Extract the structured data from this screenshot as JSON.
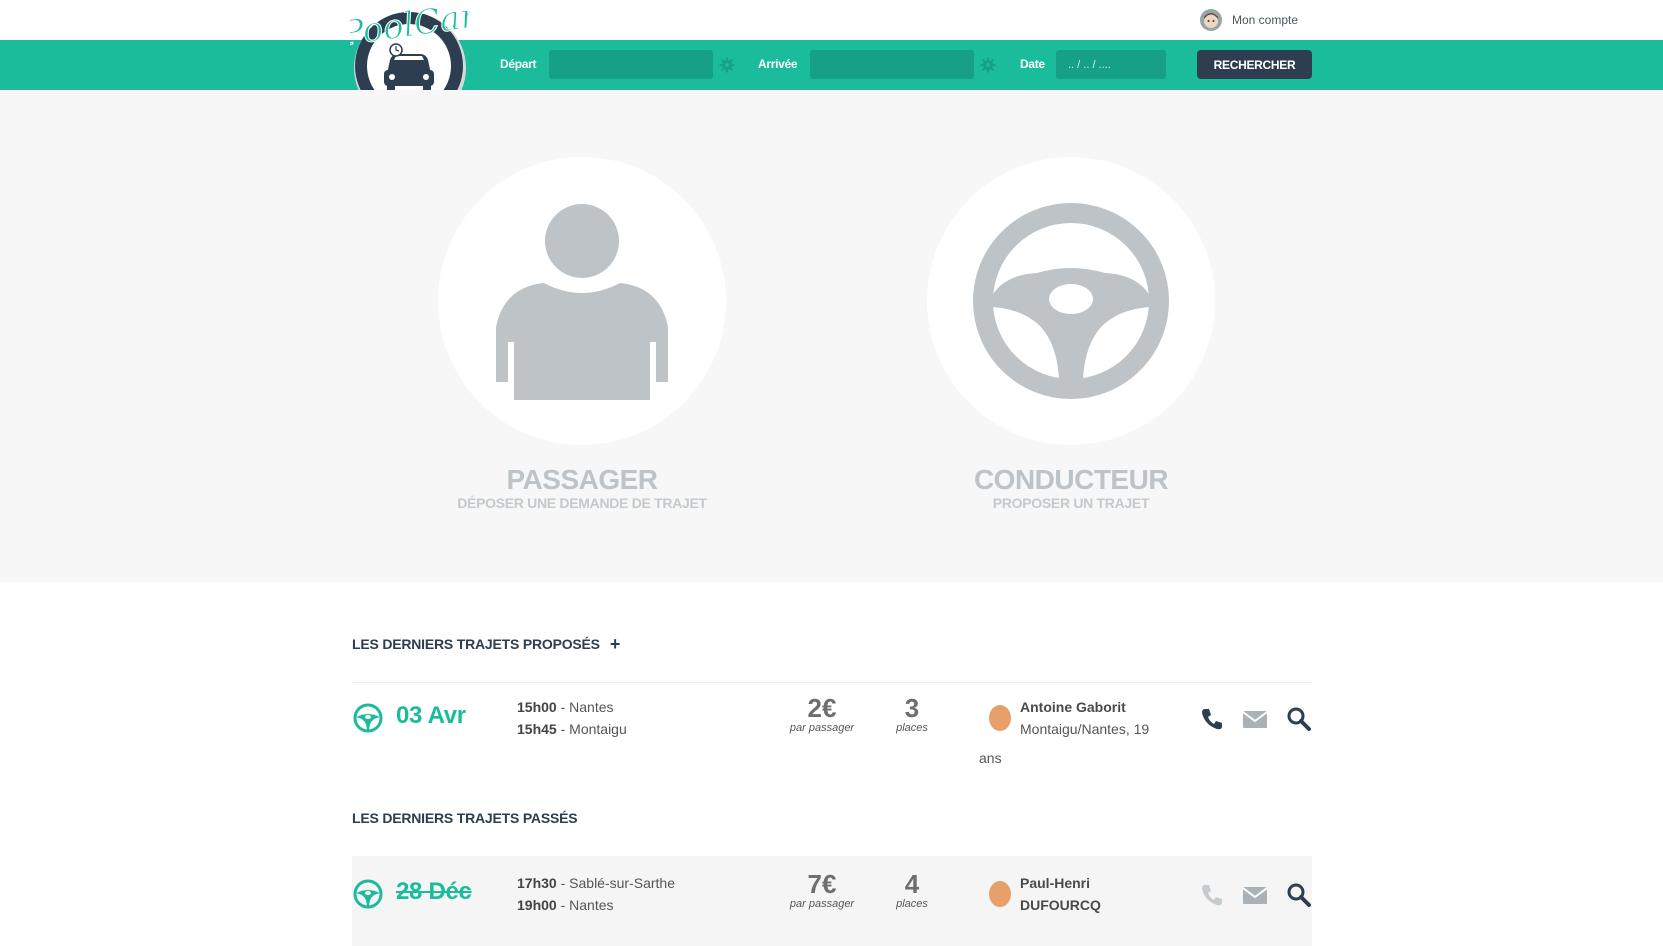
{
  "brand": {
    "name": "PoolCar"
  },
  "account": {
    "label": "Mon compte"
  },
  "search": {
    "depart_label": "Départ",
    "depart_value": "",
    "arrivee_label": "Arrivée",
    "arrivee_value": "",
    "date_label": "Date",
    "date_placeholder": ".. / .. / ....",
    "button_label": "RECHERCHER"
  },
  "roles": [
    {
      "title": "PASSAGER",
      "subtitle": "DÉPOSER UNE DEMANDE DE TRAJET",
      "icon": "person-icon"
    },
    {
      "title": "CONDUCTEUR",
      "subtitle": "PROPOSER UN TRAJET",
      "icon": "steering-wheel-icon"
    }
  ],
  "proposed": {
    "title": "LES DERNIERS TRAJETS PROPOSÉS",
    "add_label": "+",
    "trips": [
      {
        "date": "03 Avr",
        "depart_time": "15h00",
        "depart_city": "Nantes",
        "arrival_time": "15h45",
        "arrival_city": "Montaigu",
        "price": "2€",
        "price_unit": "par passager",
        "places": "3",
        "places_unit": "places",
        "driver_name": "Antoine Gaborit",
        "driver_info": "Montaigu/Nantes, 19",
        "driver_age_unit": "ans"
      }
    ]
  },
  "past": {
    "title": "LES DERNIERS TRAJETS PASSÉS",
    "trips": [
      {
        "date": "28 Déc",
        "depart_time": "17h30",
        "depart_city": "Sablé-sur-Sarthe",
        "arrival_time": "19h00",
        "arrival_city": "Nantes",
        "price": "7€",
        "price_unit": "par passager",
        "places": "4",
        "places_unit": "places",
        "driver_first": "Paul-Henri",
        "driver_last": "DUFOURCQ"
      }
    ]
  },
  "separators": {
    "dash": " - "
  },
  "colors": {
    "primary": "#1abc9c",
    "dark": "#2c3e50",
    "muted": "#bdc3c7",
    "field": "#16a085"
  }
}
